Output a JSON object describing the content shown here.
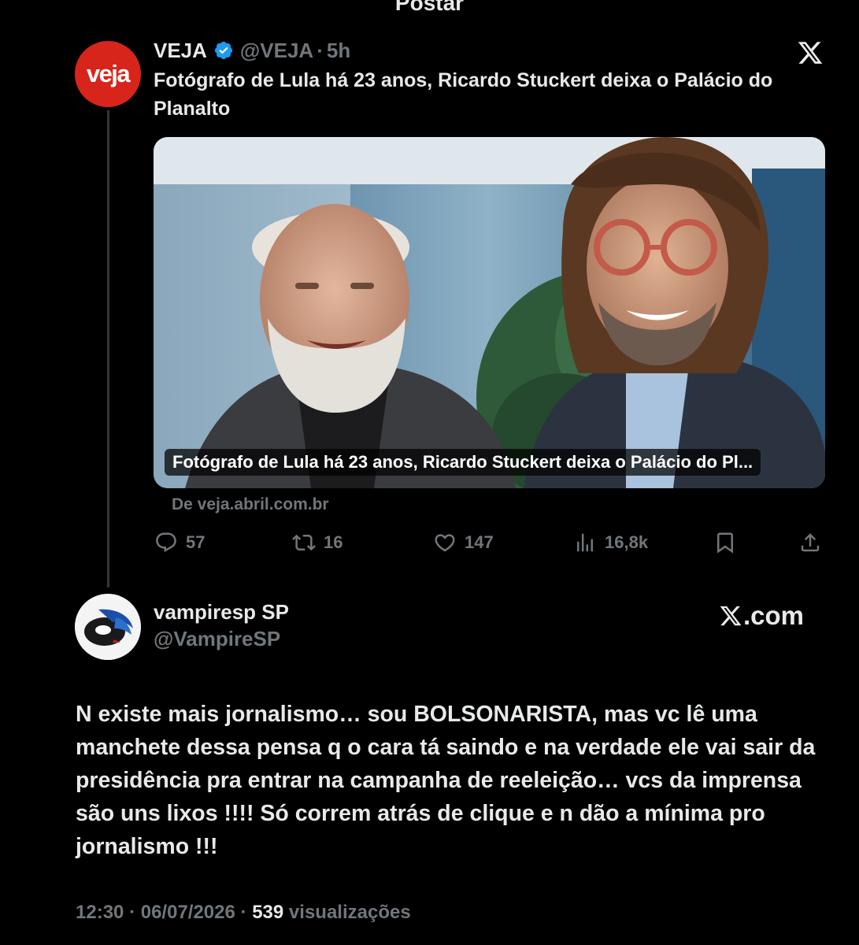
{
  "header": {
    "title": "Postar"
  },
  "quoted_post": {
    "author_name": "VEJA",
    "avatar_text": "veja",
    "handle": "@VEJA",
    "separator": "·",
    "time": "5h",
    "text": "Fotógrafo de Lula há 23 anos, Ricardo Stuckert deixa o Palácio do Planalto",
    "card": {
      "caption": "Fotógrafo de Lula há 23 anos, Ricardo Stuckert deixa o Palácio do Pl...",
      "source": "De veja.abril.com.br"
    },
    "actions": {
      "replies": "57",
      "reposts": "16",
      "likes": "147",
      "views": "16,8k"
    },
    "icons": {
      "verified": "verified-badge-icon",
      "platform": "x-logo-icon",
      "reply": "reply-icon",
      "repost": "repost-icon",
      "like": "heart-icon",
      "views": "views-icon",
      "bookmark": "bookmark-icon",
      "share": "share-icon"
    }
  },
  "reply_post": {
    "author_name": "vampiresp SP",
    "handle": "@VampireSP",
    "platform_label": ".com",
    "text": "N existe mais jornalismo… sou BOLSONARISTA, mas vc lê uma manchete dessa pensa q o cara tá saindo e na verdade ele vai sair da presidência pra entrar na campanha de reeleição… vcs da imprensa são uns lixos !!!! Só correm atrás de clique e n dão a mínima pro jornalismo !!!",
    "time": "12:30",
    "date": "06/07/2026",
    "separator": "·",
    "views_count": "539",
    "views_label": "visualizações"
  },
  "colors": {
    "background": "#000000",
    "text_primary": "#e7e9ea",
    "text_secondary": "#71767b",
    "verified_blue": "#1d9bf0",
    "veja_red": "#d8251c"
  }
}
